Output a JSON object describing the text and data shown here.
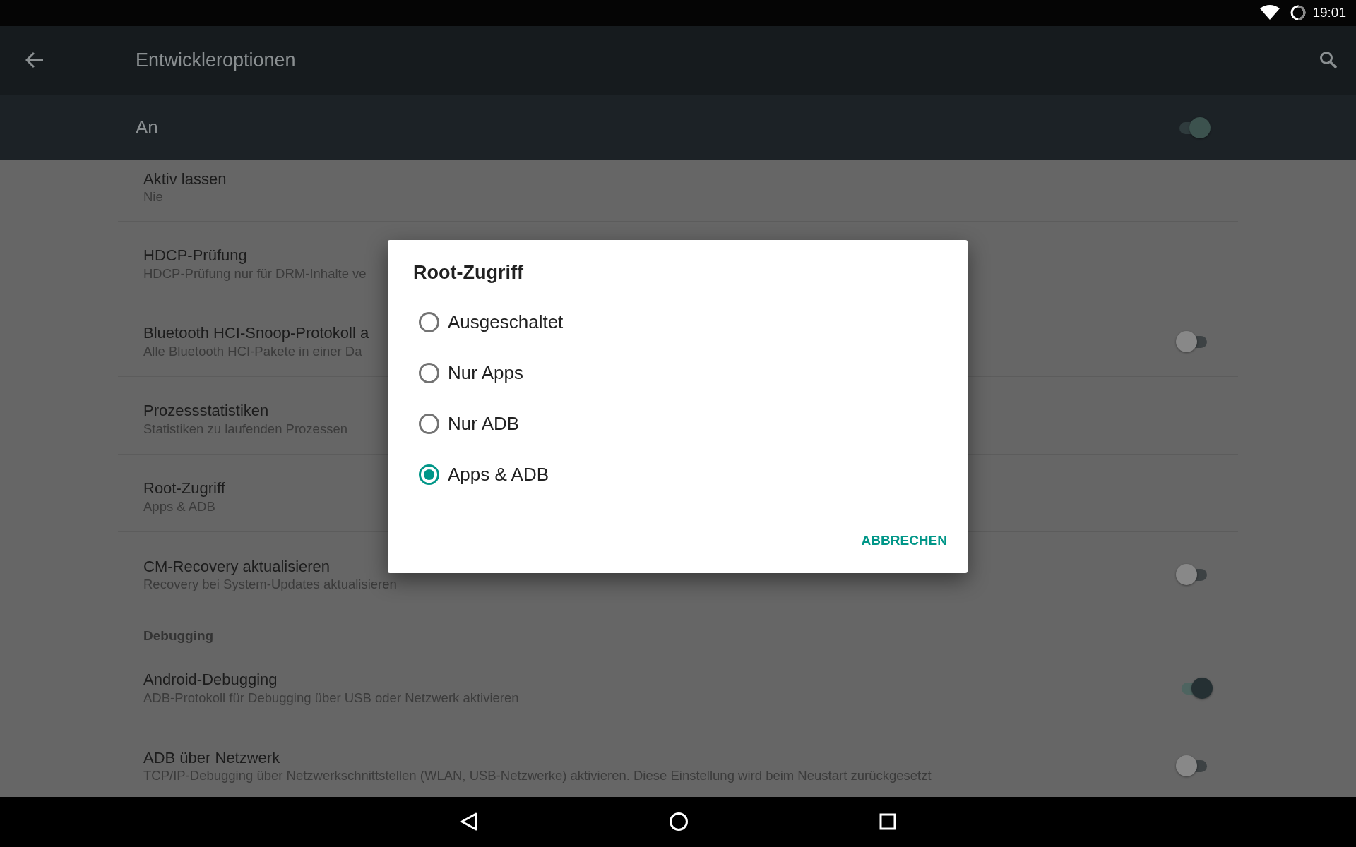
{
  "status_bar": {
    "time": "19:01"
  },
  "app_bar": {
    "title": "Entwickleroptionen"
  },
  "master_switch": {
    "label": "An",
    "on": true
  },
  "settings": [
    {
      "kind": "item",
      "title": "Aktiv lassen",
      "summary": "Nie"
    },
    {
      "kind": "item",
      "title": "HDCP-Prüfung",
      "summary": "HDCP-Prüfung nur für DRM-Inhalte ve"
    },
    {
      "kind": "switch",
      "title": "Bluetooth HCI-Snoop-Protokoll a",
      "summary": "Alle Bluetooth HCI-Pakete in einer Da",
      "on": false
    },
    {
      "kind": "item",
      "title": "Prozessstatistiken",
      "summary": "Statistiken zu laufenden Prozessen"
    },
    {
      "kind": "item",
      "title": "Root-Zugriff",
      "summary": "Apps & ADB"
    },
    {
      "kind": "switch",
      "title": "CM-Recovery aktualisieren",
      "summary": "Recovery bei System-Updates aktualisieren",
      "on": false
    },
    {
      "kind": "header",
      "title": "Debugging"
    },
    {
      "kind": "switch",
      "title": "Android-Debugging",
      "summary": "ADB-Protokoll für Debugging über USB oder Netzwerk aktivieren",
      "on": true
    },
    {
      "kind": "switch",
      "title": "ADB über Netzwerk",
      "summary": "TCP/IP-Debugging über Netzwerkschnittstellen (WLAN, USB-Netzwerke) aktivieren. Diese Einstellung wird beim Neustart zurückgesetzt",
      "on": false
    }
  ],
  "dialog": {
    "title": "Root-Zugriff",
    "options": [
      {
        "label": "Ausgeschaltet",
        "selected": false
      },
      {
        "label": "Nur Apps",
        "selected": false
      },
      {
        "label": "Nur ADB",
        "selected": false
      },
      {
        "label": "Apps & ADB",
        "selected": true
      }
    ],
    "buttons": [
      "ABBRECHEN"
    ]
  }
}
